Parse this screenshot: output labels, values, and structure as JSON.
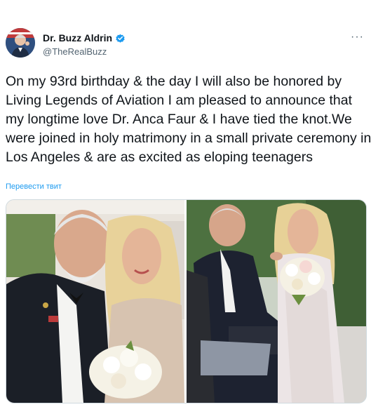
{
  "tweet": {
    "author_name": "Dr. Buzz Aldrin",
    "handle": "@TheRealBuzz",
    "more_label": "···",
    "text": "On my 93rd birthday & the day I will also be honored by Living Legends of Aviation I am pleased to announce that my longtime love Dr. Anca Faur & I have tied the knot.We were joined in holy matrimony in a small private ceremony in Los Angeles & are as excited as eloping teenagers",
    "translate_label": "Перевести твит"
  },
  "icons": {
    "verified": "verified-badge-icon",
    "more": "more-options-icon"
  },
  "colors": {
    "accent": "#1d9bf0",
    "text_primary": "#0f1419",
    "text_secondary": "#536471"
  }
}
